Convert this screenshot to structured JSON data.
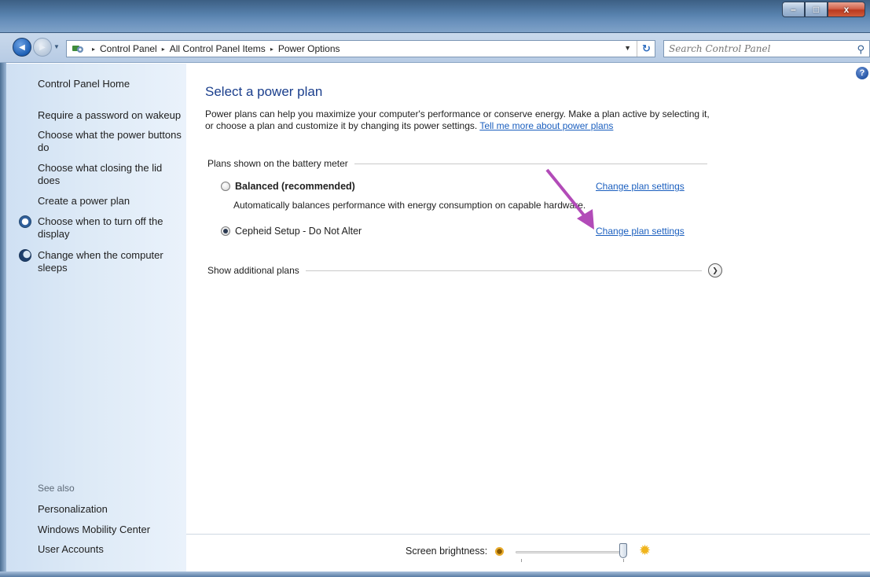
{
  "window": {
    "controls": {
      "minimize": "–",
      "maximize": "□",
      "close": "x"
    }
  },
  "nav": {
    "back_glyph": "◀",
    "forward_glyph": "▶",
    "breadcrumbs": [
      "Control Panel",
      "All Control Panel Items",
      "Power Options"
    ],
    "separator": "▸",
    "search_placeholder": "Search Control Panel",
    "refresh_glyph": "↻"
  },
  "sidebar": {
    "home": "Control Panel Home",
    "items": [
      "Require a password on wakeup",
      "Choose what the power buttons do",
      "Choose what closing the lid does",
      "Create a power plan",
      "Choose when to turn off the display",
      "Change when the computer sleeps"
    ],
    "see_also_title": "See also",
    "see_also": [
      "Personalization",
      "Windows Mobility Center",
      "User Accounts"
    ]
  },
  "main": {
    "title": "Select a power plan",
    "intro_text": "Power plans can help you maximize your computer's performance or conserve energy. Make a plan active by selecting it, or choose a plan and customize it by changing its power settings. ",
    "intro_link": "Tell me more about power plans",
    "group_label": "Plans shown on the battery meter",
    "plans": [
      {
        "name": "Balanced (recommended)",
        "selected": false,
        "bold": true,
        "description": "Automatically balances performance with energy consumption on capable hardware.",
        "link": "Change plan settings"
      },
      {
        "name": "Cepheid Setup - Do Not Alter",
        "selected": true,
        "bold": false,
        "description": "",
        "link": "Change plan settings"
      }
    ],
    "show_more_label": "Show additional plans",
    "help_glyph": "?"
  },
  "brightness": {
    "label": "Screen brightness:",
    "level_fraction": 0.95
  },
  "colors": {
    "title_blue": "#1a3e8c",
    "link_blue": "#1b5fbf",
    "annotation_arrow": "#b24bb8"
  }
}
